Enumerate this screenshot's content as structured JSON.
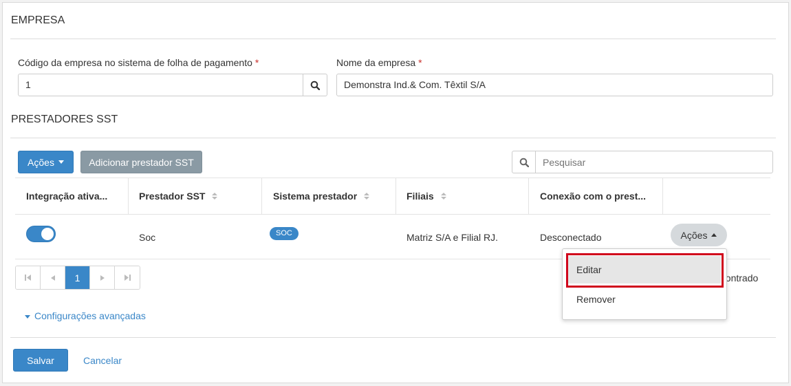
{
  "empresa": {
    "title": "EMPRESA",
    "codigo_label": "Código da empresa no sistema de folha de pagamento",
    "codigo_value": "1",
    "nome_label": "Nome da empresa",
    "nome_value": "Demonstra Ind.& Com. Têxtil S/A",
    "required_mark": "*"
  },
  "prestadores": {
    "title": "PRESTADORES SST",
    "acoes_label": "Ações",
    "add_label": "Adicionar prestador SST",
    "search_placeholder": "Pesquisar",
    "columns": [
      "Integração ativa...",
      "Prestador SST",
      "Sistema prestador",
      "Filiais",
      "Conexão com o prest..."
    ],
    "rows": [
      {
        "integracao": true,
        "prestador": "Soc",
        "sistema": "SOC",
        "filiais": "Matriz S/A e Filial RJ.",
        "conexao": "Desconectado",
        "acoes": "Ações"
      }
    ],
    "pagination": {
      "current_page": "1"
    },
    "footer_text": "ncontrado",
    "dropdown": {
      "items": [
        "Editar",
        "Remover"
      ]
    }
  },
  "advanced": {
    "label": "Configurações avançadas"
  },
  "actions": {
    "save": "Salvar",
    "cancel": "Cancelar"
  },
  "colors": {
    "primary": "#3a87c8",
    "secondary": "#8a9aa4",
    "highlight": "#d0021b"
  }
}
